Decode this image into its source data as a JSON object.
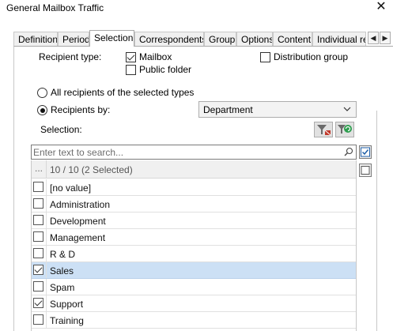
{
  "window": {
    "title": "General Mailbox Traffic",
    "close_glyph": "✕"
  },
  "tabs": [
    {
      "label": "Definition",
      "active": false
    },
    {
      "label": "Period",
      "active": false
    },
    {
      "label": "Selection",
      "active": true
    },
    {
      "label": "Correspondents",
      "active": false
    },
    {
      "label": "Group",
      "active": false
    },
    {
      "label": "Options",
      "active": false
    },
    {
      "label": "Content",
      "active": false
    },
    {
      "label": "Individual re",
      "active": false
    }
  ],
  "tab_scroll": {
    "left_glyph": "◀",
    "right_glyph": "▶"
  },
  "recipient_type": {
    "label": "Recipient type:",
    "mailbox": {
      "label": "Mailbox",
      "checked": true
    },
    "public_folder": {
      "label": "Public folder",
      "checked": false
    },
    "distribution_group": {
      "label": "Distribution group",
      "checked": false
    }
  },
  "scope": {
    "all_recipients": {
      "label": "All recipients of the selected types",
      "checked": false
    },
    "recipients_by": {
      "label": "Recipients by:",
      "checked": true
    }
  },
  "recipients_by_dropdown": {
    "value": "Department"
  },
  "selection": {
    "label": "Selection:",
    "filter_button_icon": "filter-clear-icon",
    "refresh_button_icon": "filter-refresh-icon"
  },
  "search": {
    "placeholder": "Enter text to search..."
  },
  "list": {
    "header_dots": "...",
    "header_text": "10 / 10 (2 Selected)",
    "items": [
      {
        "label": "[no value]",
        "checked": false,
        "selected": false
      },
      {
        "label": "Administration",
        "checked": false,
        "selected": false
      },
      {
        "label": "Development",
        "checked": false,
        "selected": false
      },
      {
        "label": "Management",
        "checked": false,
        "selected": false
      },
      {
        "label": "R & D",
        "checked": false,
        "selected": false
      },
      {
        "label": "Sales",
        "checked": true,
        "selected": true
      },
      {
        "label": "Spam",
        "checked": false,
        "selected": false
      },
      {
        "label": "Support",
        "checked": true,
        "selected": false
      },
      {
        "label": "Training",
        "checked": false,
        "selected": false
      }
    ]
  },
  "side_buttons": {
    "check_all_icon": "check-all-icon",
    "uncheck_all_icon": "uncheck-all-icon"
  },
  "colors": {
    "selected_row": "#cce0f5",
    "accent": "#1f5fa8"
  }
}
